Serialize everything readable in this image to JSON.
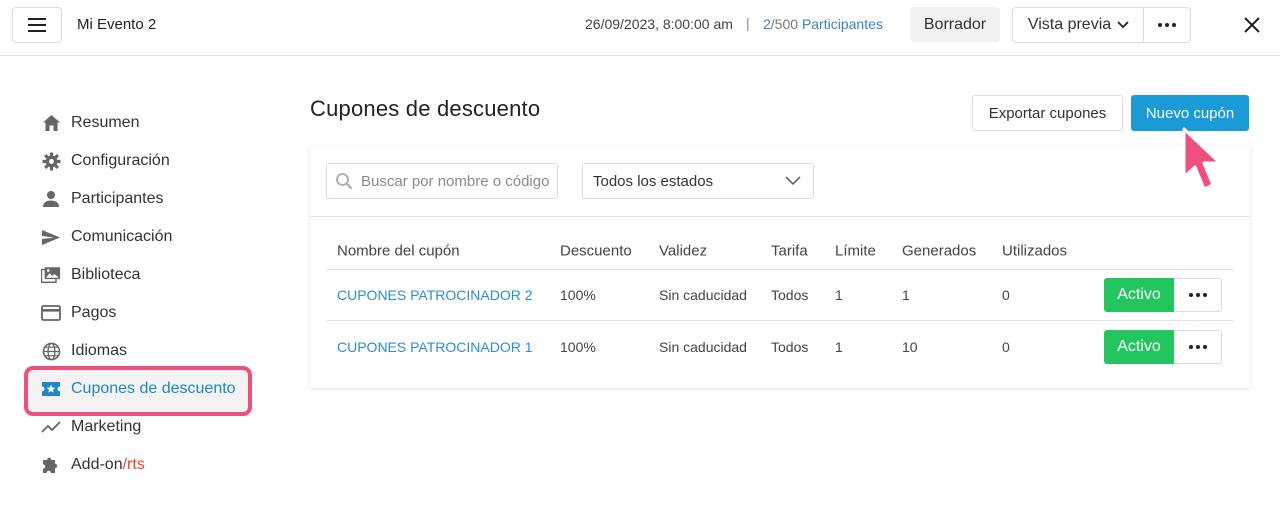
{
  "header": {
    "event_title": "Mi Evento 2",
    "datetime": "26/09/2023, 8:00:00 am",
    "separator": "|",
    "participants_count": "2",
    "participants_total": "/500",
    "participants_label": "Participantes",
    "status": "Borrador",
    "preview": "Vista previa"
  },
  "sidebar": {
    "items": [
      {
        "label": "Resumen",
        "icon": "home-icon"
      },
      {
        "label": "Configuración",
        "icon": "gear-icon"
      },
      {
        "label": "Participantes",
        "icon": "person-icon"
      },
      {
        "label": "Comunicación",
        "icon": "send-icon"
      },
      {
        "label": "Biblioteca",
        "icon": "images-icon"
      },
      {
        "label": "Pagos",
        "icon": "card-icon"
      },
      {
        "label": "Idiomas",
        "icon": "globe-icon"
      },
      {
        "label": "Cupones de descuento",
        "icon": "coupon-icon"
      },
      {
        "label": "Marketing",
        "icon": "trend-icon"
      },
      {
        "label": "Add-on",
        "label_suffix": "/rts",
        "icon": "puzzle-icon"
      }
    ]
  },
  "main": {
    "title": "Cupones de descuento",
    "export_label": "Exportar cupones",
    "new_label": "Nuevo cupón",
    "search_placeholder": "Buscar por nombre o código",
    "status_filter": "Todos los estados",
    "columns": [
      "Nombre del cupón",
      "Descuento",
      "Validez",
      "Tarifa",
      "Límite",
      "Generados",
      "Utilizados"
    ],
    "rows": [
      {
        "name": "CUPONES PATROCINADOR 2",
        "discount": "100%",
        "validity": "Sin caducidad",
        "rate": "Todos",
        "limit": "1",
        "generated": "1",
        "used": "0",
        "status": "Activo"
      },
      {
        "name": "CUPONES PATROCINADOR 1",
        "discount": "100%",
        "validity": "Sin caducidad",
        "rate": "Todos",
        "limit": "1",
        "generated": "10",
        "used": "0",
        "status": "Activo"
      }
    ]
  },
  "colors": {
    "accent": "#1a9bd7",
    "active_green": "#22c55e",
    "highlight_pink": "#ee4f7d",
    "link_blue": "#2f8dcf"
  }
}
